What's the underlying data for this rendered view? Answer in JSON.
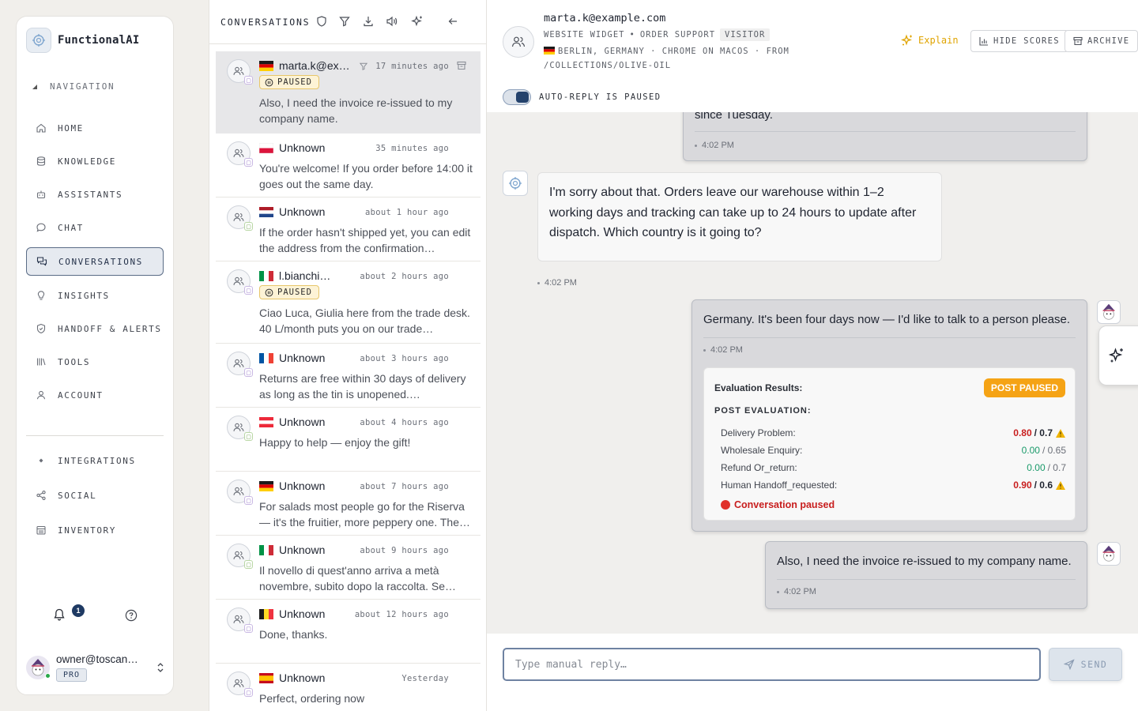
{
  "app": {
    "name": "FunctionalAI"
  },
  "sidebar": {
    "nav_header": "NAVIGATION",
    "items": [
      {
        "label": "HOME",
        "icon": "home-icon"
      },
      {
        "label": "KNOWLEDGE",
        "icon": "database-icon"
      },
      {
        "label": "ASSISTANTS",
        "icon": "robot-icon"
      },
      {
        "label": "CHAT",
        "icon": "chat-bubble-icon"
      },
      {
        "label": "CONVERSATIONS",
        "icon": "conversations-icon",
        "active": true
      },
      {
        "label": "INSIGHTS",
        "icon": "lightbulb-icon"
      },
      {
        "label": "HANDOFF & ALERTS",
        "icon": "shield-icon"
      },
      {
        "label": "TOOLS",
        "icon": "tools-icon"
      },
      {
        "label": "ACCOUNT",
        "icon": "user-icon"
      }
    ],
    "integrations_header": "INTEGRATIONS",
    "integrations": [
      {
        "label": "SOCIAL",
        "icon": "share-icon"
      },
      {
        "label": "INVENTORY",
        "icon": "inventory-icon"
      }
    ],
    "notifications_count": "1",
    "user": {
      "email": "owner@toscan…",
      "plan": "PRO"
    }
  },
  "conversations": {
    "title": "CONVERSATIONS",
    "list": [
      {
        "flag": "de",
        "name": "marta.k@ex…",
        "time": "17 minutes ago",
        "paused": true,
        "text": "Also, I need the invoice re-issued to my company name.",
        "selected": true,
        "channel": "purple"
      },
      {
        "flag": "pl",
        "name": "Unknown",
        "time": "35 minutes ago",
        "paused": false,
        "text": "You're welcome! If you order before 14:00 it goes out the same day.",
        "channel": "purple"
      },
      {
        "flag": "nl",
        "name": "Unknown",
        "time": "about 1 hour ago",
        "paused": false,
        "text": "If the order hasn't shipped yet, you can edit the address from the confirmation…",
        "channel": "green"
      },
      {
        "flag": "it",
        "name": "l.bianchi…",
        "time": "about 2 hours ago",
        "paused": true,
        "text": "Ciao Luca, Giulia here from the trade desk. 40 L/month puts you on our trade…",
        "channel": "purple"
      },
      {
        "flag": "fr",
        "name": "Unknown",
        "time": "about 3 hours ago",
        "paused": false,
        "text": "Returns are free within 30 days of delivery as long as the tin is unopened.…",
        "channel": "purple"
      },
      {
        "flag": "at",
        "name": "Unknown",
        "time": "about 4 hours ago",
        "paused": false,
        "text": "Happy to help — enjoy the gift!",
        "channel": "green"
      },
      {
        "flag": "de",
        "name": "Unknown",
        "time": "about 7 hours ago",
        "paused": false,
        "text": "For salads most people go for the Riserva — it's the fruitier, more peppery one. The…",
        "channel": "purple"
      },
      {
        "flag": "it",
        "name": "Unknown",
        "time": "about 9 hours ago",
        "paused": false,
        "text": "Il novello di quest'anno arriva a metà novembre, subito dopo la raccolta. Se…",
        "channel": "green"
      },
      {
        "flag": "be",
        "name": "Unknown",
        "time": "about 12 hours ago",
        "paused": false,
        "text": "Done, thanks.",
        "channel": "purple"
      },
      {
        "flag": "es",
        "name": "Unknown",
        "time": "Yesterday",
        "paused": false,
        "text": "Perfect, ordering now",
        "channel": "purple"
      }
    ],
    "paused_label": "PAUSED"
  },
  "detail": {
    "email": "marta.k@example.com",
    "source": "WEBSITE WIDGET",
    "sep": "•",
    "team": "ORDER SUPPORT",
    "role": "VISITOR",
    "location_line": "BERLIN, GERMANY · CHROME ON MACOS · FROM /COLLECTIONS/OLIVE-OIL",
    "explain_label": "Explain",
    "hide_scores_label": "HIDE SCORES",
    "archive_label": "ARCHIVE",
    "autoreply_label": "AUTO-REPLY IS PAUSED"
  },
  "messages": {
    "cut_text": "since Tuesday.",
    "cut_time": "4:02 PM",
    "bot_text": "I'm sorry about that. Orders leave our warehouse within 1–2 working days and tracking can take up to 24 hours to update after dispatch. Which country is it going to?",
    "bot_time": "4:02 PM",
    "user1_text": "Germany. It's been four days now — I'd like to talk to a person please.",
    "user1_time": "4:02 PM",
    "user2_text": "Also, I need the invoice re-issued to my company name.",
    "user2_time": "4:02 PM"
  },
  "evaluation": {
    "title": "Evaluation Results:",
    "status": "POST PAUSED",
    "section": "POST EVALUATION:",
    "rows": [
      {
        "label": "Delivery Problem:",
        "score": "0.80",
        "threshold": "/ 0.7",
        "exceeded": true
      },
      {
        "label": "Wholesale Enquiry:",
        "score": "0.00",
        "threshold": "/ 0.65",
        "exceeded": false
      },
      {
        "label": "Refund Or_return:",
        "score": "0.00",
        "threshold": "/ 0.7",
        "exceeded": false
      },
      {
        "label": "Human Handoff_requested:",
        "score": "0.90",
        "threshold": "/ 0.6",
        "exceeded": true
      }
    ],
    "paused_note": "Conversation paused",
    "colors": {
      "exceeded": "#c81e1e",
      "ok": "#1a9a6a",
      "warning": "#f0b400"
    }
  },
  "composer": {
    "placeholder": "Type manual reply…",
    "send_label": "SEND"
  }
}
